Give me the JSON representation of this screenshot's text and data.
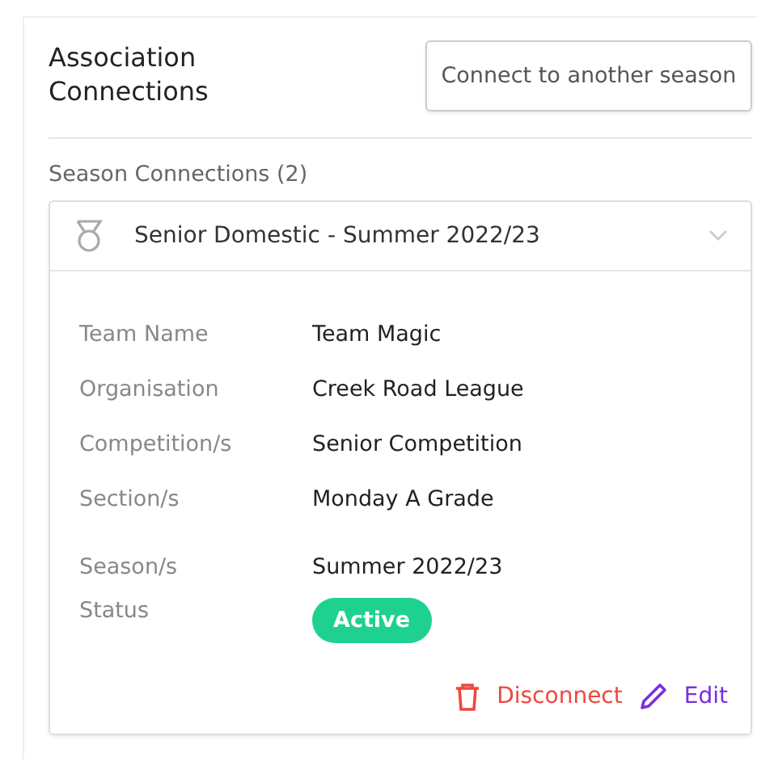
{
  "panel": {
    "title": "Association Connections",
    "connect_button": "Connect to another season"
  },
  "section_title": "Season Connections (2)",
  "connection": {
    "title": "Senior Domestic - Summer 2022/23",
    "expanded": true,
    "details": [
      {
        "label": "Team Name",
        "value": "Team Magic",
        "kind": "text"
      },
      {
        "label": "Organisation",
        "value": "Creek Road League",
        "kind": "text"
      },
      {
        "label": "Competition/s",
        "value": "Senior Competition",
        "kind": "text"
      },
      {
        "label": "Section/s",
        "value": "Monday A Grade",
        "kind": "text"
      },
      {
        "label": "Season/s",
        "value": "Summer 2022/23",
        "kind": "text"
      },
      {
        "label": "Status",
        "value": "Active",
        "kind": "status",
        "color": "#1fd18f"
      }
    ],
    "actions": [
      {
        "label": "Disconnect",
        "kind": "delete"
      },
      {
        "label": "Edit",
        "kind": "edit"
      }
    ]
  }
}
